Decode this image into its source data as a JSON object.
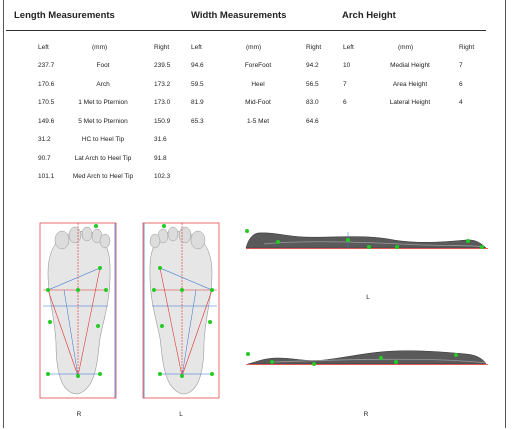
{
  "sections": {
    "length": {
      "title": "Length Measurements",
      "columns": [
        "Left",
        "(mm)",
        "Right"
      ],
      "rows": [
        {
          "left": "237.7",
          "label": "Foot",
          "right": "239.5"
        },
        {
          "left": "170.6",
          "label": "Arch",
          "right": "173.2"
        },
        {
          "left": "170.5",
          "label": "1 Met to Pternion",
          "right": "173.0"
        },
        {
          "left": "149.6",
          "label": "5 Met to Pternion",
          "right": "150.9"
        },
        {
          "left": "31.2",
          "label": "HC to Heel Tip",
          "right": "31.6"
        },
        {
          "left": "90.7",
          "label": "Lat Arch to Heel Tip",
          "right": "91.8"
        },
        {
          "left": "101.1",
          "label": "Med Arch to Heel Tip",
          "right": "102.3"
        }
      ]
    },
    "width": {
      "title": "Width Measurements",
      "columns": [
        "Left",
        "(mm)",
        "Right"
      ],
      "rows": [
        {
          "left": "94.6",
          "label": "ForeFoot",
          "right": "94.2"
        },
        {
          "left": "59.5",
          "label": "Heel",
          "right": "56.5"
        },
        {
          "left": "81.9",
          "label": "Mid-Foot",
          "right": "83.0"
        },
        {
          "left": "65.3",
          "label": "1-5 Met",
          "right": "64.6"
        }
      ]
    },
    "arch": {
      "title": "Arch Height",
      "columns": [
        "Left",
        "(mm)",
        "Right"
      ],
      "rows": [
        {
          "left": "10",
          "label": "Medial Height",
          "right": "7"
        },
        {
          "left": "7",
          "label": "Area Height",
          "right": "6"
        },
        {
          "left": "6",
          "label": "Lateral Height",
          "right": "4"
        }
      ]
    }
  },
  "images": {
    "right_foot_caption": "R",
    "left_foot_caption": "L",
    "profile_top_caption": "L",
    "profile_bottom_caption": "R"
  },
  "colors": {
    "marker": "#22cc22",
    "line_red": "#e03030",
    "line_blue": "#3070d0",
    "foot_fill": "#e6e6e6"
  }
}
